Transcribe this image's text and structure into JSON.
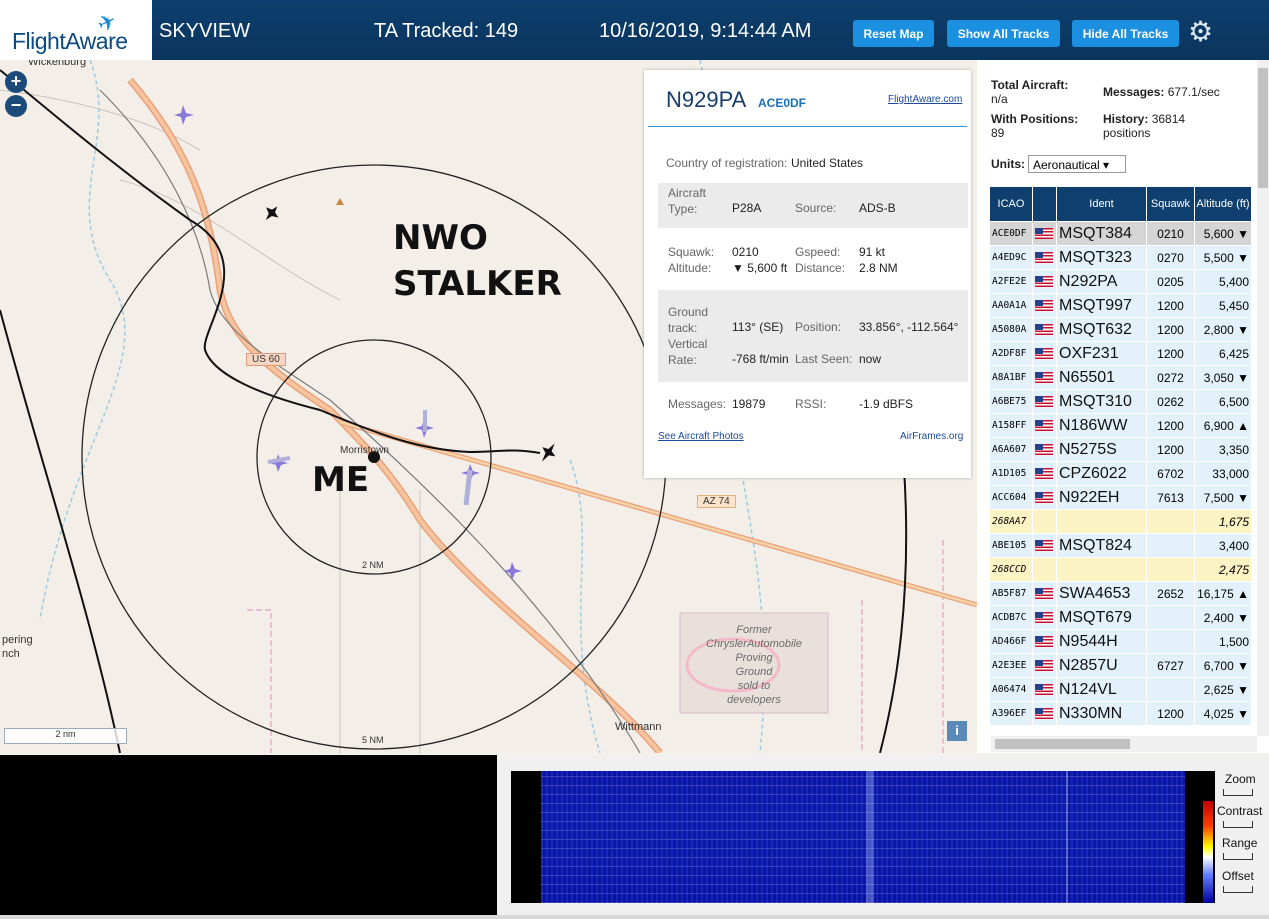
{
  "header": {
    "logo_text": "FlightAware",
    "app_name": "SKYVIEW",
    "tracked": "TA Tracked: 149",
    "datetime": "10/16/2019, 9:14:44 AM",
    "buttons": {
      "reset": "Reset Map",
      "show": "Show All Tracks",
      "hide": "Hide All Tracks"
    }
  },
  "map": {
    "places": {
      "wickenburg": "Wickenburg",
      "morristown": "Morristown",
      "wittmann": "Wittmann",
      "pering": "pering",
      "nch": "nch"
    },
    "roads": {
      "us60": "US 60",
      "az74": "AZ 74"
    },
    "rings": {
      "inner": "2 NM",
      "outer": "5 NM"
    },
    "proving_ground": [
      "Former",
      "ChryslerAutomobile",
      "Proving",
      "Ground",
      "sold to",
      "developers"
    ],
    "annotation_stalker": [
      "NWO",
      "STALKER"
    ],
    "annotation_me": "ME",
    "scale": "2 nm",
    "zoom_in": "+",
    "zoom_out": "−",
    "info": "i"
  },
  "popup": {
    "callsign": "N929PA",
    "icao": "ACE0DF",
    "fa_link": "FlightAware.com",
    "country_label": "Country of registration:",
    "country": "United States",
    "aircraft_type_label": "Aircraft Type:",
    "aircraft_type": "P28A",
    "source_label": "Source:",
    "source": "ADS-B",
    "squawk_label": "Squawk:",
    "squawk": "0210",
    "gspeed_label": "Gspeed:",
    "gspeed": "91 kt",
    "altitude_label": "Altitude:",
    "altitude": "▼ 5,600 ft",
    "distance_label": "Distance:",
    "distance": "2.8 NM",
    "ground_track_label": "Ground track:",
    "ground_track": "113° (SE)",
    "position_label": "Position:",
    "position": "33.856°, -112.564°",
    "vrate_label": "Vertical Rate:",
    "vrate": "-768 ft/min",
    "last_seen_label": "Last Seen:",
    "last_seen": "now",
    "messages_label": "Messages:",
    "messages": "19879",
    "rssi_label": "RSSI:",
    "rssi": "-1.9 dBFS",
    "photos_link": "See Aircraft Photos",
    "airframes_link": "AirFrames.org"
  },
  "stats": {
    "total_label": "Total Aircraft:",
    "total": "n/a",
    "messages_label": "Messages:",
    "messages": "677.1/sec",
    "positions_label": "With Positions:",
    "positions": "89",
    "history_label": "History:",
    "history": "36814 positions",
    "units_label": "Units:",
    "units": "Aeronautical ▾"
  },
  "table": {
    "headers": [
      "ICAO",
      "",
      "Ident",
      "Squawk",
      "Altitude (ft)"
    ],
    "rows": [
      {
        "icao": "ACE0DF",
        "flag": true,
        "ident": "MSQT384",
        "squawk": "0210",
        "alt": "5,600 ▼",
        "style": "sel"
      },
      {
        "icao": "A4ED9C",
        "flag": true,
        "ident": "MSQT323",
        "squawk": "0270",
        "alt": "5,500 ▼",
        "style": ""
      },
      {
        "icao": "A2FE2E",
        "flag": true,
        "ident": "N292PA",
        "squawk": "0205",
        "alt": "5,400",
        "style": ""
      },
      {
        "icao": "AA0A1A",
        "flag": true,
        "ident": "MSQT997",
        "squawk": "1200",
        "alt": "5,450",
        "style": ""
      },
      {
        "icao": "A5080A",
        "flag": true,
        "ident": "MSQT632",
        "squawk": "1200",
        "alt": "2,800 ▼",
        "style": ""
      },
      {
        "icao": "A2DF8F",
        "flag": true,
        "ident": "OXF231",
        "squawk": "1200",
        "alt": "6,425",
        "style": ""
      },
      {
        "icao": "A8A1BF",
        "flag": true,
        "ident": "N65501",
        "squawk": "0272",
        "alt": "3,050 ▼",
        "style": ""
      },
      {
        "icao": "A6BE75",
        "flag": true,
        "ident": "MSQT310",
        "squawk": "0262",
        "alt": "6,500",
        "style": ""
      },
      {
        "icao": "A158FF",
        "flag": true,
        "ident": "N186WW",
        "squawk": "1200",
        "alt": "6,900 ▲",
        "style": ""
      },
      {
        "icao": "A6A607",
        "flag": true,
        "ident": "N5275S",
        "squawk": "1200",
        "alt": "3,350",
        "style": ""
      },
      {
        "icao": "A1D105",
        "flag": true,
        "ident": "CPZ6022",
        "squawk": "6702",
        "alt": "33,000",
        "style": ""
      },
      {
        "icao": "ACC604",
        "flag": true,
        "ident": "N922EH",
        "squawk": "7613",
        "alt": "7,500 ▼",
        "style": ""
      },
      {
        "icao": "268AA7",
        "flag": false,
        "ident": "",
        "squawk": "",
        "alt": "1,675",
        "style": "yel"
      },
      {
        "icao": "ABE105",
        "flag": true,
        "ident": "MSQT824",
        "squawk": "",
        "alt": "3,400",
        "style": ""
      },
      {
        "icao": "268CCD",
        "flag": false,
        "ident": "",
        "squawk": "",
        "alt": "2,475",
        "style": "yel"
      },
      {
        "icao": "AB5F87",
        "flag": true,
        "ident": "SWA4653",
        "squawk": "2652",
        "alt": "16,175 ▲",
        "style": ""
      },
      {
        "icao": "ACDB7C",
        "flag": true,
        "ident": "MSQT679",
        "squawk": "",
        "alt": "2,400 ▼",
        "style": ""
      },
      {
        "icao": "AD466F",
        "flag": true,
        "ident": "N9544H",
        "squawk": "",
        "alt": "1,500",
        "style": ""
      },
      {
        "icao": "A2E3EE",
        "flag": true,
        "ident": "N2857U",
        "squawk": "6727",
        "alt": "6,700 ▼",
        "style": ""
      },
      {
        "icao": "A06474",
        "flag": true,
        "ident": "N124VL",
        "squawk": "",
        "alt": "2,625 ▼",
        "style": ""
      },
      {
        "icao": "A396EF",
        "flag": true,
        "ident": "N330MN",
        "squawk": "1200",
        "alt": "4,025 ▼",
        "style": ""
      }
    ]
  },
  "spectrum_controls": {
    "zoom": "Zoom",
    "contrast": "Contrast",
    "range": "Range",
    "offset": "Offset"
  },
  "colors": {
    "header": "#0d3f6e",
    "button": "#1b8fe0",
    "table_header": "#0f3f6e",
    "row": "#e3f1fb",
    "row_yellow": "#fcf3c4",
    "road": "#f5a56e"
  }
}
